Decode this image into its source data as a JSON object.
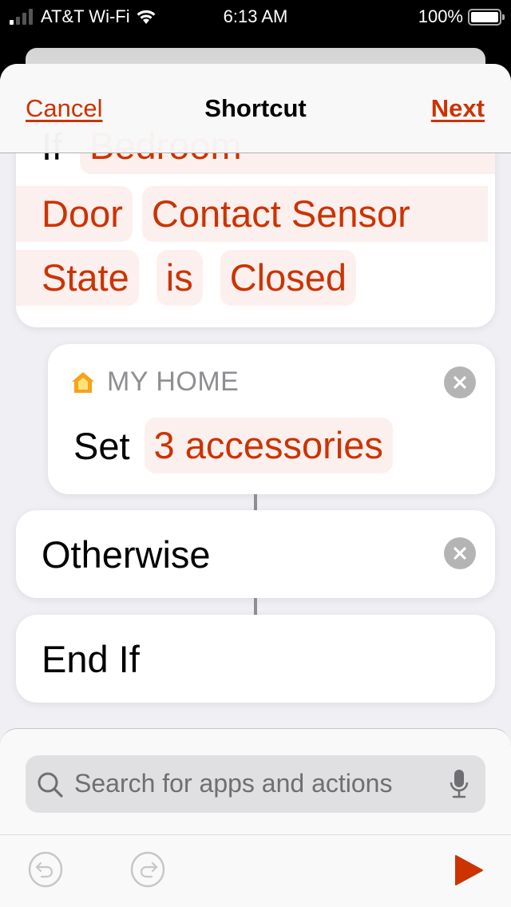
{
  "status_bar": {
    "carrier": "AT&T Wi-Fi",
    "signal_bars_active": 1,
    "signal_bars_total": 4,
    "time": "6:13 AM",
    "battery_percent": "100%"
  },
  "nav": {
    "cancel_label": "Cancel",
    "title": "Shortcut",
    "next_label": "Next"
  },
  "if_action": {
    "keyword": "If",
    "tokens_row1": [
      "Bedroom"
    ],
    "tokens_row2": [
      "Door",
      "Contact Sensor"
    ],
    "tokens_row3": [
      "State",
      "is",
      "Closed"
    ]
  },
  "home_action": {
    "app_name": "MY HOME",
    "verb": "Set",
    "parameter": "3 accessories"
  },
  "otherwise_action": {
    "label": "Otherwise"
  },
  "endif_action": {
    "label": "End If"
  },
  "search": {
    "placeholder": "Search for apps and actions"
  },
  "colors": {
    "accent": "#cc3300",
    "token_bg": "#fcf0ee",
    "background": "#efeff4"
  }
}
